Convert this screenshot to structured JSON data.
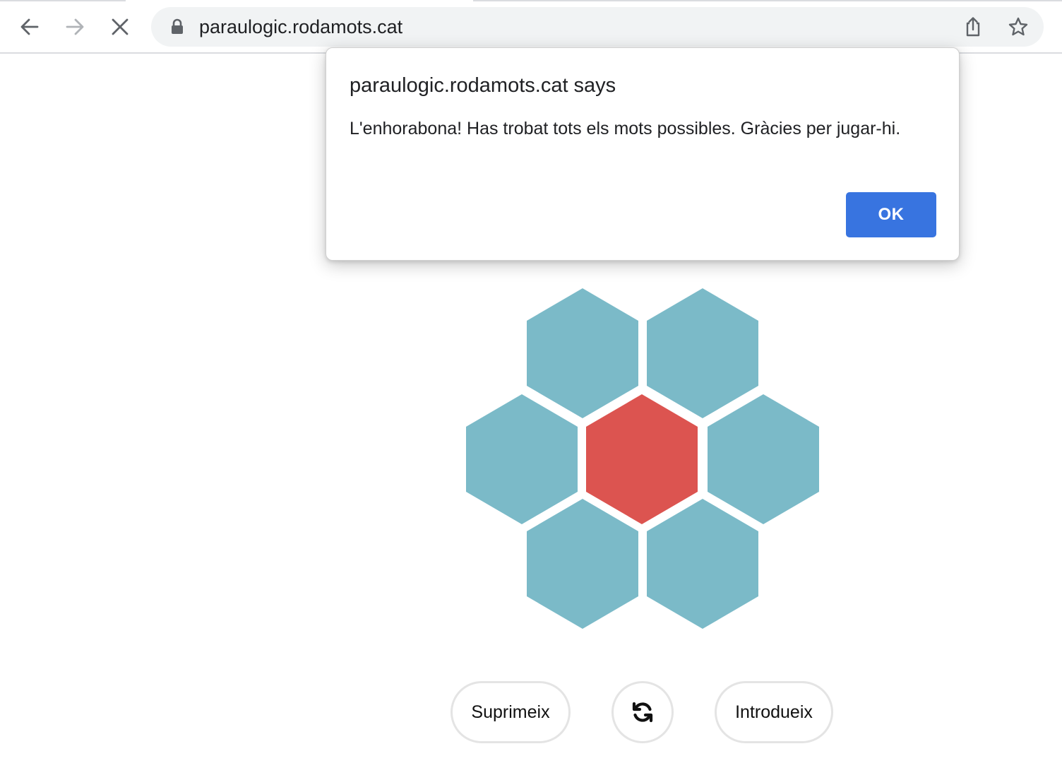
{
  "browser": {
    "url": "paraulogic.rodamots.cat",
    "icons": {
      "back": "arrow-left-icon",
      "forward": "arrow-right-icon",
      "stop": "close-icon",
      "lock": "lock-icon",
      "share": "share-icon",
      "bookmark": "star-icon"
    },
    "forward_enabled": false
  },
  "dialog": {
    "title": "paraulogic.rodamots.cat says",
    "message": "L'enhorabona! Has trobat tots els mots possibles. Gràcies per jugar-hi.",
    "ok_label": "OK",
    "ok_color": "#3874e0"
  },
  "game": {
    "colors": {
      "outer_cell": "#7bbac8",
      "center_cell": "#dc5450"
    },
    "buttons": {
      "delete_label": "Suprimeix",
      "shuffle_icon": "shuffle-icon",
      "enter_label": "Introdueix"
    }
  }
}
